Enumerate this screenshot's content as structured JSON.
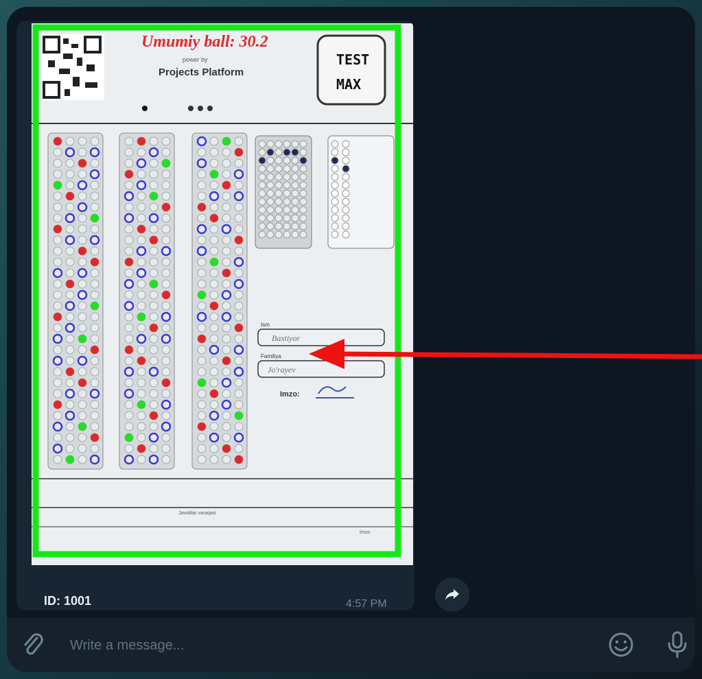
{
  "message": {
    "caption": "ID: 1001",
    "time": "4:57 PM"
  },
  "sheet": {
    "score_title": "Umumiy ball: 30.2",
    "powered_by": "power by",
    "platform": "Projects Platform",
    "logo_line1": "TEST",
    "logo_line2": "MAX",
    "label_name": "Ism",
    "label_surname": "Familiya",
    "name_value": "Baxtiyor",
    "surname_value": "Jo'rayev",
    "signature_label": "Imzo:",
    "footer_line1": "Javoblar varaqasi",
    "footer_line2": "Imzo"
  },
  "composer": {
    "placeholder": "Write a message..."
  },
  "colors": {
    "highlight_green": "#19e619",
    "arrow_red": "#ee1111",
    "wrong_red": "#e0282b",
    "correct_blue": "#3a3ad6",
    "filled_green": "#22e022"
  }
}
